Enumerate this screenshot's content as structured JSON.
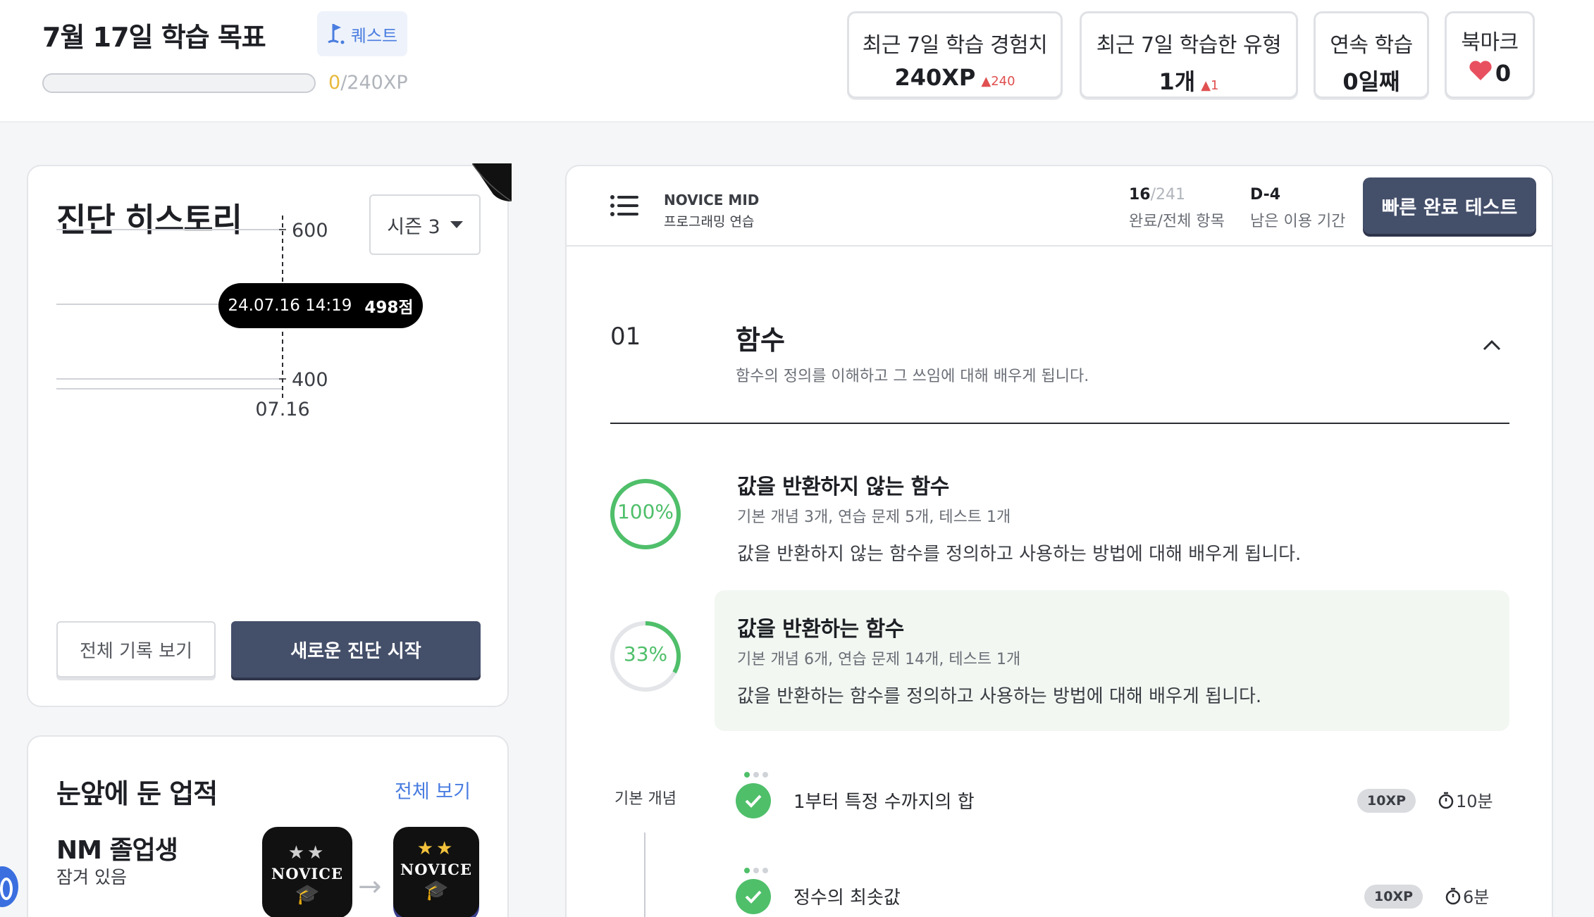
{
  "header": {
    "goal_title": "7월 17일 학습 목표",
    "quest_label": "퀘스트",
    "xp_current": "0",
    "xp_total": "/240XP",
    "xp_progress_percent": 0,
    "stats": [
      {
        "label": "최근 7일 학습 경험치",
        "value": "240XP",
        "delta": "▲240"
      },
      {
        "label": "최근 7일 학습한 유형",
        "value": "1개",
        "delta": "▲1"
      },
      {
        "label": "연속 학습",
        "value": "0일째",
        "delta": ""
      },
      {
        "label": "북마크",
        "value": "0",
        "icon": "heart-icon"
      }
    ]
  },
  "history": {
    "title": "진단 히스토리",
    "season_label": "시즌 3",
    "tooltip_date": "24.07.16 14:19",
    "tooltip_score": "498점",
    "btn_all": "전체 기록 보기",
    "btn_new": "새로운 진단 시작"
  },
  "chart_data": {
    "type": "line",
    "x": [
      "07.16"
    ],
    "series": [
      {
        "values": [
          498
        ]
      }
    ],
    "yticks": [
      400,
      500,
      600
    ],
    "ylim": [
      400,
      600
    ],
    "xlabel": "",
    "ylabel": "",
    "grid": true,
    "point_color": "#4a74d8"
  },
  "achievements": {
    "title": "눈앞에 둔 업적",
    "see_all": "전체 보기",
    "name": "NM 졸업생",
    "status": "잠겨 있음",
    "badge_word": "NOVICE"
  },
  "course": {
    "level": "NOVICE MID",
    "subtitle": "프로그래밍 연습",
    "done": "16",
    "total": "/241",
    "progress_label": "완료/전체 항목",
    "dday": "D-4",
    "dday_label": "남은 이용 기간",
    "quick_test": "빠른 완료 테스트",
    "chapter": {
      "num": "01",
      "title": "함수",
      "desc": "함수의 정의를 이해하고 그 쓰임에 대해 배우게 됩니다."
    },
    "units": [
      {
        "title": "값을 반환하지 않는 함수",
        "meta": "기본 개념 3개, 연습 문제 5개, 테스트 1개",
        "desc": "값을 반환하지 않는 함수를 정의하고 사용하는 방법에 대해 배우게 됩니다.",
        "progress": "100%",
        "fraction": 1.0
      },
      {
        "title": "값을 반환하는 함수",
        "meta": "기본 개념 6개, 연습 문제 14개, 테스트 1개",
        "desc": "값을 반환하는 함수를 정의하고 사용하는 방법에 대해 배우게 됩니다.",
        "progress": "33%",
        "fraction": 0.33
      }
    ],
    "section_label": "기본 개념",
    "lessons": [
      {
        "title": "1부터 특정 수까지의 합",
        "xp": "10XP",
        "time": "10분"
      },
      {
        "title": "정수의 최솟값",
        "xp": "10XP",
        "time": "6분"
      }
    ]
  },
  "colors": {
    "accent_green": "#4fbf6a",
    "accent_blue": "#4a7de0",
    "dark_button": "#444f6a",
    "delta_red": "#e05050"
  }
}
